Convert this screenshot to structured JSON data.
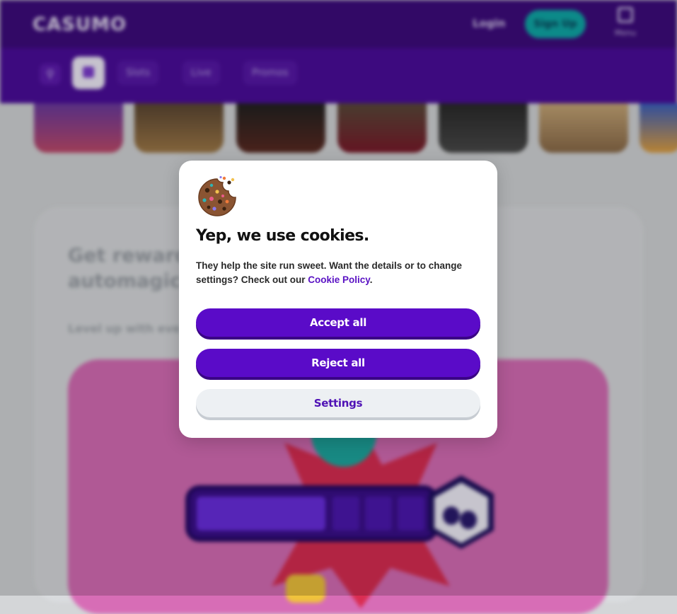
{
  "background": {
    "logo": "CASUMO",
    "login_label": "Login",
    "signup_label": "Sign Up",
    "menu_label": "Menu",
    "nav": {
      "search_icon": "search-icon",
      "home_icon": "home-icon",
      "items": [
        "Slots",
        "Live",
        "Promos"
      ]
    },
    "promo_heading_line1": "Get reward",
    "promo_heading_line2": "automagic",
    "promo_sub": "Level up with eve"
  },
  "cookie_modal": {
    "icon": "cookie-icon",
    "title": "Yep, we use cookies.",
    "body_text": "They help the site run sweet. Want the details or to change settings? Check out our ",
    "policy_link": "Cookie Policy",
    "body_end": ".",
    "accept_label": "Accept all",
    "reject_label": "Reject all",
    "settings_label": "Settings"
  },
  "colors": {
    "brand_purple": "#5a0bc8",
    "link_purple": "#5a12c4",
    "header_purple": "#3d0b7d"
  }
}
